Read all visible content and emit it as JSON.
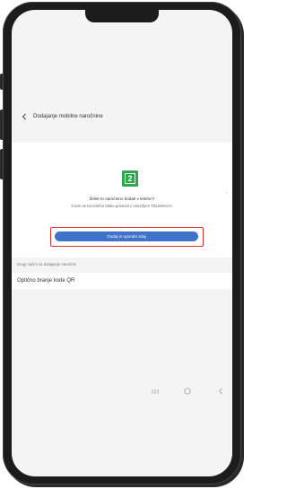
{
  "header": {
    "title": "Dodajanje mobilne naročnine"
  },
  "prompt": {
    "sim_number": "2",
    "question": "Želite to naročnino dodati v telefon?",
    "description": "S tem se bo telefon lahko povezal z omrežjem TELEMACH.",
    "add_button_label": "Dodaj in uporabi zdaj"
  },
  "other_methods": {
    "section_label": "Drugi načini za dodajanje naročnin",
    "qr_option_label": "Optično branje kode QR"
  },
  "icons": {
    "back": "back-chevron-icon",
    "sim": "sim-card-icon",
    "nav_recents": "recents-icon",
    "nav_home": "home-icon",
    "nav_back": "back-icon"
  },
  "colors": {
    "sim_icon": "#2aa84a",
    "add_button": "#3f73c9",
    "highlight": "#d9342b"
  }
}
